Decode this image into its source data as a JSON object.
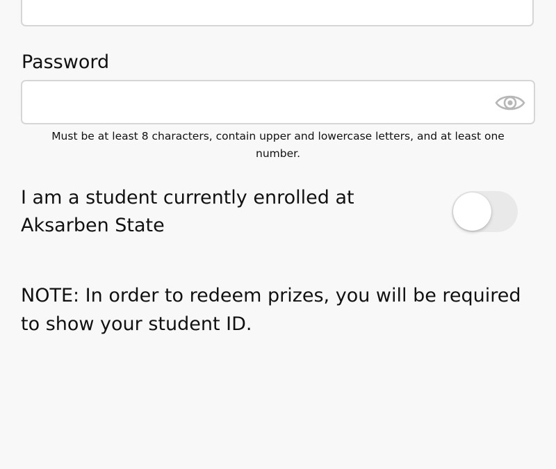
{
  "form": {
    "password": {
      "label": "Password",
      "value": "",
      "hint": "Must be at least 8 characters, contain upper and lowercase letters, and at least one number.",
      "show_password_icon": "eye-icon"
    },
    "student_toggle": {
      "label": "I am a student currently enrolled at Aksarben State",
      "checked": false,
      "off_color": "#e9e9ea"
    },
    "note": "NOTE: In order to redeem prizes, you will be required to show your student ID."
  }
}
